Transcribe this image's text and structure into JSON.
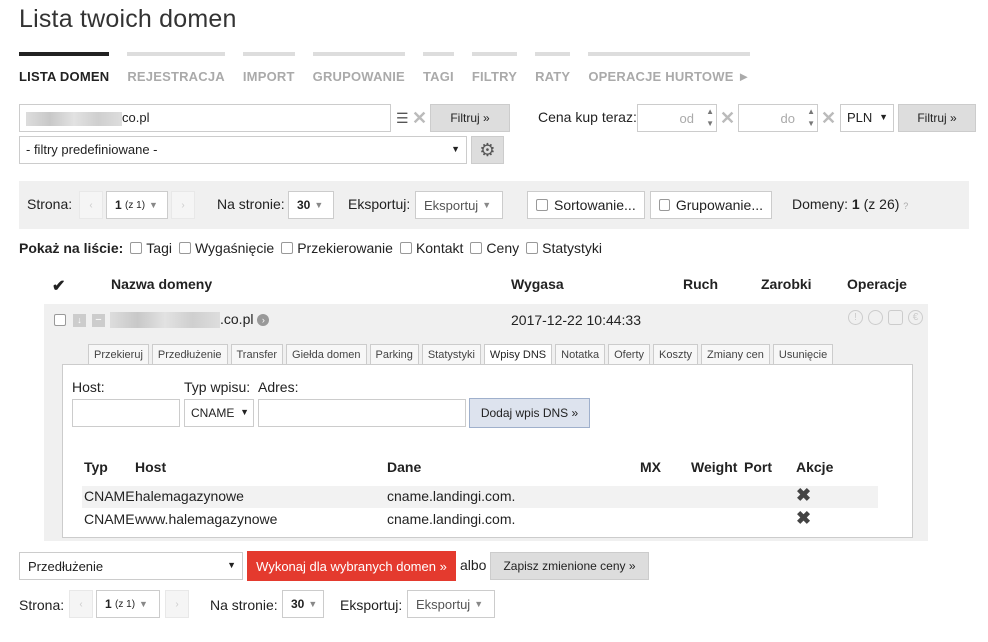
{
  "title": "Lista twoich domen",
  "nav": [
    "LISTA DOMEN",
    "REJESTRACJA",
    "IMPORT",
    "GRUPOWANIE",
    "TAGI",
    "FILTRY",
    "RATY",
    "OPERACJE HURTOWE ►"
  ],
  "filter": {
    "search_value_suffix": "co.pl",
    "filter_button": "Filtruj »",
    "predefined": "- filtry predefiniowane -",
    "price_label": "Cena kup teraz:",
    "price_from_placeholder": "od",
    "price_to_placeholder": "do",
    "currency": "PLN",
    "price_filter_button": "Filtruj »"
  },
  "pager_top": {
    "page_label": "Strona:",
    "page_value": "1",
    "page_of": "(z 1)",
    "per_page_label": "Na stronie:",
    "per_page_value": "30",
    "export_label": "Eksportuj:",
    "export_value": "Eksportuj",
    "sort_label": "Sortowanie...",
    "group_label": "Grupowanie...",
    "domains_label": "Domeny:",
    "domains_count": "1",
    "domains_total": "(z 26)"
  },
  "show_list": {
    "label": "Pokaż na liście:",
    "options": [
      "Tagi",
      "Wygaśnięcie",
      "Przekierowanie",
      "Kontakt",
      "Ceny",
      "Statystyki"
    ]
  },
  "table_headers": {
    "check": "✔",
    "name": "Nazwa domeny",
    "expires": "Wygasa",
    "traffic": "Ruch",
    "earnings": "Zarobki",
    "operations": "Operacje"
  },
  "domain": {
    "name_suffix": ".co.pl",
    "expires": "2017-12-22 10:44:33"
  },
  "tabs": [
    "Przekieruj",
    "Przedłużenie",
    "Transfer",
    "Giełda domen",
    "Parking",
    "Statystyki",
    "Wpisy DNS",
    "Notatka",
    "Oferty",
    "Koszty",
    "Zmiany cen",
    "Usunięcie"
  ],
  "active_tab": "Wpisy DNS",
  "dns_form": {
    "host_label": "Host:",
    "type_label": "Typ wpisu:",
    "address_label": "Adres:",
    "type_value": "CNAME",
    "add_button": "Dodaj wpis DNS »"
  },
  "dns_headers": {
    "type": "Typ",
    "host": "Host",
    "data": "Dane",
    "mx": "MX",
    "weight": "Weight",
    "port": "Port",
    "actions": "Akcje"
  },
  "dns_records": [
    {
      "type": "CNAME",
      "host": "halemagazynowe",
      "data": "cname.landingi.com."
    },
    {
      "type": "CNAME",
      "host": "www.halemagazynowe",
      "data": "cname.landingi.com."
    }
  ],
  "bottom": {
    "action_select": "Przedłużenie",
    "execute_button": "Wykonaj dla wybranych domen »",
    "or_text": "albo",
    "save_prices_button": "Zapisz zmienione ceny »"
  },
  "pager_bottom": {
    "page_label": "Strona:",
    "page_value": "1",
    "page_of": "(z 1)",
    "per_page_label": "Na stronie:",
    "per_page_value": "30",
    "export_label": "Eksportuj:",
    "export_value": "Eksportuj"
  },
  "colors": {
    "accent_red": "#e43a2e",
    "active_tab_border": "#222222",
    "inactive_nav": "#aaaaaa",
    "panel_bg": "#f0f0f0",
    "dns_button_bg": "#dde3ee"
  }
}
